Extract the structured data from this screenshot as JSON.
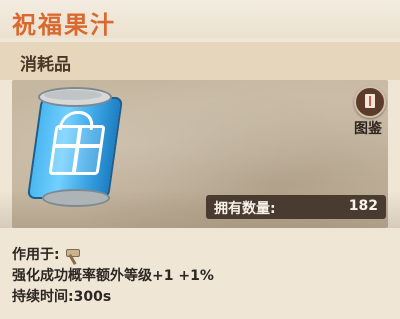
{
  "title": "祝福果汁",
  "category": "消耗品",
  "catalog": {
    "label": "图鉴"
  },
  "count": {
    "label": "拥有数量:",
    "value": "182"
  },
  "description": {
    "use_for_label": "作用于:",
    "effect": "强化成功概率额外等级+1 +1%",
    "duration": "持续时间:300s"
  },
  "icons": {
    "item": "blessing-juice-can-icon",
    "catalog": "catalog-book-icon",
    "target": "hammer-icon"
  },
  "colors": {
    "title": "#d9692f",
    "can_blue": "#4bb7f0"
  }
}
